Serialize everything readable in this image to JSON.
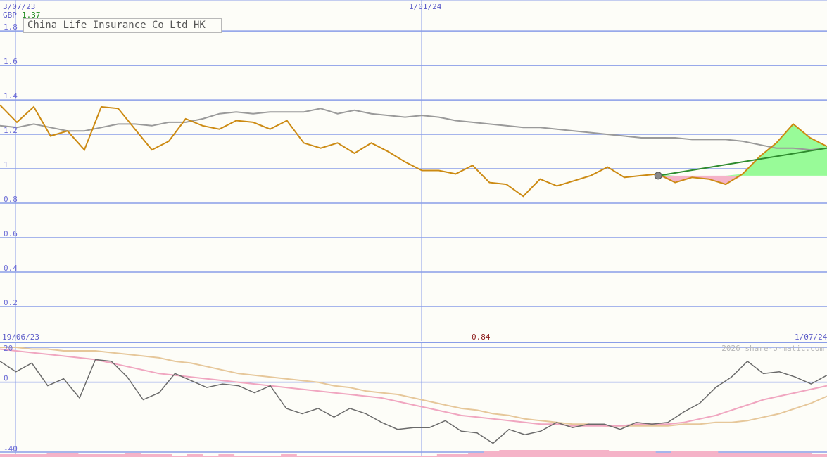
{
  "chart_title": "China Life Insurance Co Ltd HK",
  "currency": "GBP",
  "last_price": "1.37",
  "top_dates": {
    "start": "3/07/23",
    "mid": "1/01/24"
  },
  "bottom_dates": {
    "start": "19/06/23",
    "end": "1/07/24"
  },
  "center_value": "0.84",
  "watermark": "2026 share-o-matic.com",
  "colors": {
    "price": "#cc8a12",
    "moving_avg": "#9a9a9a",
    "trend": "#2e8b2e",
    "gain_fill": "#98fb98",
    "loss_fill": "#f5b3c8",
    "grid": "#8a9de8",
    "osc_main": "#6a6a6a",
    "osc_pink": "#f0a6c0",
    "osc_tan": "#e6c79a",
    "volume": "#f5b3c8"
  },
  "chart_data": [
    {
      "type": "line",
      "y_ticks": [
        "1.8",
        "1.6",
        "1.4",
        "1.2",
        "1",
        "0.8",
        "0.6",
        "0.4",
        "0.2"
      ],
      "ylim": [
        0.0,
        1.98
      ],
      "x_index_range": [
        0,
        49
      ],
      "series": [
        {
          "role": "price",
          "values": [
            1.37,
            1.27,
            1.36,
            1.19,
            1.22,
            1.11,
            1.36,
            1.35,
            1.23,
            1.11,
            1.16,
            1.29,
            1.25,
            1.23,
            1.28,
            1.27,
            1.23,
            1.28,
            1.15,
            1.12,
            1.15,
            1.09,
            1.15,
            1.1,
            1.04,
            0.99,
            0.99,
            0.97,
            1.02,
            0.92,
            0.91,
            0.84,
            0.94,
            0.9,
            0.93,
            0.96,
            1.01,
            0.95,
            0.96,
            0.97,
            0.92,
            0.95,
            0.94,
            0.91,
            0.97,
            1.07,
            1.15,
            1.26,
            1.18,
            1.13
          ]
        },
        {
          "role": "moving_average",
          "values": [
            1.25,
            1.24,
            1.26,
            1.24,
            1.22,
            1.22,
            1.24,
            1.26,
            1.26,
            1.25,
            1.27,
            1.27,
            1.29,
            1.32,
            1.33,
            1.32,
            1.33,
            1.33,
            1.33,
            1.35,
            1.32,
            1.34,
            1.32,
            1.31,
            1.3,
            1.31,
            1.3,
            1.28,
            1.27,
            1.26,
            1.25,
            1.24,
            1.24,
            1.23,
            1.22,
            1.21,
            1.2,
            1.19,
            1.18,
            1.18,
            1.18,
            1.17,
            1.17,
            1.17,
            1.16,
            1.14,
            1.12,
            1.12,
            1.11,
            1.12
          ]
        }
      ],
      "trend_line": {
        "start": [
          39,
          0.96
        ],
        "end": [
          49,
          1.12
        ]
      }
    },
    {
      "type": "line",
      "y_ticks": [
        "20",
        "0",
        "-40"
      ],
      "ylim": [
        -40,
        20
      ],
      "series": [
        {
          "role": "oscillator",
          "values": [
            12,
            6,
            11,
            -2,
            2,
            -9,
            13,
            12,
            3,
            -10,
            -6,
            5,
            1,
            -3,
            -1,
            -2,
            -6,
            -2,
            -15,
            -18,
            -15,
            -20,
            -15,
            -18,
            -23,
            -27,
            -26,
            -26,
            -22,
            -28,
            -29,
            -35,
            -27,
            -30,
            -28,
            -23,
            -26,
            -24,
            -24,
            -27,
            -23,
            -24,
            -23,
            -17,
            -12,
            -3,
            3,
            12,
            5,
            6,
            3,
            -1,
            4
          ]
        },
        {
          "role": "signal_fast",
          "values": [
            19,
            18,
            17,
            16,
            15,
            14,
            13,
            11,
            9,
            7,
            5,
            4,
            3,
            2,
            1,
            0,
            -1,
            -2,
            -3,
            -4,
            -5,
            -6,
            -7,
            -8,
            -9,
            -11,
            -13,
            -15,
            -17,
            -19,
            -20,
            -21,
            -22,
            -23,
            -24,
            -24,
            -25,
            -25,
            -25,
            -25,
            -24,
            -24,
            -24,
            -23,
            -21,
            -19,
            -16,
            -13,
            -10,
            -8,
            -6,
            -4,
            -2
          ]
        },
        {
          "role": "signal_slow",
          "values": [
            20,
            20,
            19,
            19,
            18,
            18,
            18,
            17,
            16,
            15,
            14,
            12,
            11,
            9,
            7,
            5,
            4,
            3,
            2,
            1,
            0,
            -2,
            -3,
            -5,
            -6,
            -7,
            -9,
            -11,
            -13,
            -15,
            -16,
            -18,
            -19,
            -21,
            -22,
            -23,
            -24,
            -24,
            -25,
            -25,
            -25,
            -25,
            -25,
            -24,
            -24,
            -23,
            -23,
            -22,
            -20,
            -18,
            -15,
            -12,
            -8
          ]
        }
      ],
      "volume_levels": [
        2,
        2,
        2,
        3,
        3,
        2,
        2,
        2,
        3,
        2,
        2,
        1,
        2,
        1,
        2,
        1,
        1,
        1,
        2,
        1,
        1,
        1,
        1,
        1,
        1,
        1,
        1,
        1,
        2,
        2,
        3,
        4,
        5,
        5,
        5,
        5,
        5,
        5,
        5,
        4,
        4,
        4,
        3,
        4,
        4,
        4,
        3,
        3,
        3,
        3,
        3,
        3,
        2
      ]
    }
  ]
}
